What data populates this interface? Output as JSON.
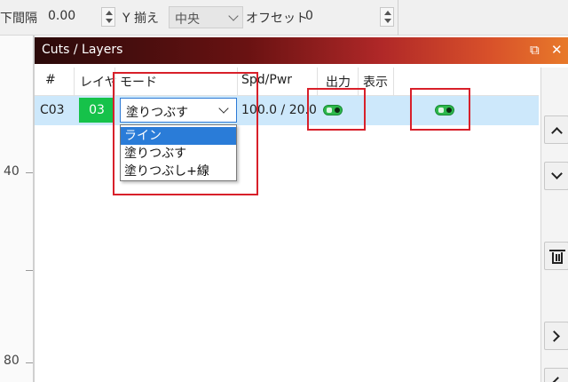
{
  "toolbar": {
    "spacing_label": "下間隔",
    "spacing_value": "0.00",
    "y_align_label": "Y 揃え",
    "y_align_value": "中央",
    "offset_label": "オフセット",
    "offset_value": "0"
  },
  "ruler": {
    "labels": [
      "40",
      "80"
    ]
  },
  "panel": {
    "title": "Cuts / Layers",
    "float_icon": "⧉",
    "close_icon": "✕",
    "columns": [
      "#",
      "レイヤ",
      "モード",
      "Spd/Pwr",
      "出力",
      "表示"
    ],
    "row": {
      "num": "C03",
      "layer": "03",
      "layer_color": "#16c24a",
      "mode": "塗りつぶす",
      "spd_pwr": "100.0 / 20.0",
      "output_on": true,
      "show_on": true
    },
    "mode_options": [
      "ライン",
      "塗りつぶす",
      "塗りつぶし+線"
    ],
    "selected_option": "ライン"
  },
  "side_buttons": [
    "move-up",
    "move-down",
    "delete",
    "expand-right",
    "collapse-left"
  ]
}
